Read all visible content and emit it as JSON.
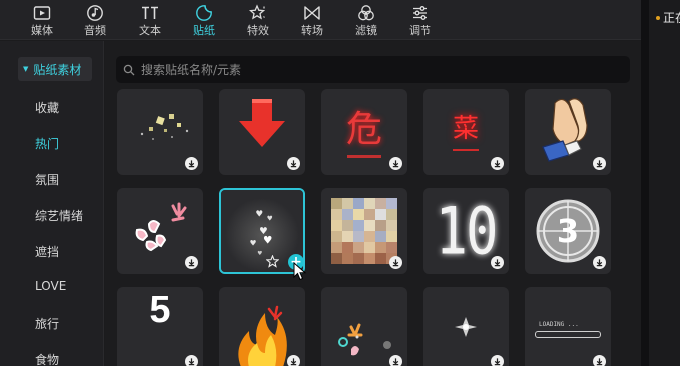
{
  "toolbar": {
    "items": [
      {
        "label": "媒体",
        "icon": "media-icon"
      },
      {
        "label": "音频",
        "icon": "audio-icon"
      },
      {
        "label": "文本",
        "icon": "text-icon"
      },
      {
        "label": "贴纸",
        "icon": "sticker-icon",
        "active": true
      },
      {
        "label": "特效",
        "icon": "effects-icon"
      },
      {
        "label": "转场",
        "icon": "transition-icon"
      },
      {
        "label": "滤镜",
        "icon": "filter-icon"
      },
      {
        "label": "调节",
        "icon": "adjust-icon"
      }
    ]
  },
  "right_panel": {
    "text": "正在"
  },
  "sidebar": {
    "category": "贴纸素材",
    "items": [
      {
        "label": "收藏"
      },
      {
        "label": "热门",
        "active": true
      },
      {
        "label": "氛围"
      },
      {
        "label": "综艺情绪"
      },
      {
        "label": "遮挡"
      },
      {
        "label": "LOVE"
      },
      {
        "label": "旅行"
      },
      {
        "label": "食物"
      }
    ]
  },
  "search": {
    "placeholder": "搜索贴纸名称/元素",
    "value": ""
  },
  "stickers": {
    "red_char_1": "危",
    "red_char_2": "菜",
    "countdown_digits": "10",
    "circle_number": "3",
    "number_five": "5",
    "loading_text": "LOADING ..."
  },
  "colors": {
    "accent": "#3fd2e0",
    "selected_border": "#2ec4d6",
    "arrow_red": "#e8322b",
    "neon_red": "#e83a3a"
  }
}
